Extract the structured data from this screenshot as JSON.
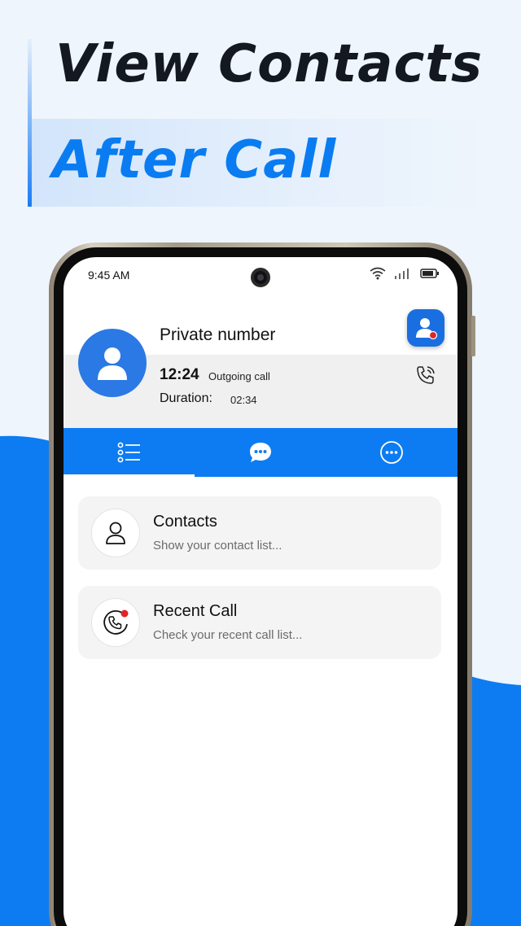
{
  "promo": {
    "headline_line1": "View Contacts",
    "headline_line2": "After Call"
  },
  "colors": {
    "accent": "#0d7cf2",
    "background": "#eef5fc",
    "headline_dark": "#141820",
    "missed_dot": "#e02424"
  },
  "status_bar": {
    "time": "9:45 AM",
    "icons": [
      "wifi-icon",
      "signal-icon",
      "battery-icon"
    ]
  },
  "caller": {
    "name": "Private number",
    "time": "12:24",
    "call_type": "Outgoing call",
    "duration_label": "Duration:",
    "duration_value": "02:34",
    "avatar_icon": "person-icon",
    "call_icon": "phone-call-icon"
  },
  "tabs": [
    {
      "icon": "list-icon",
      "active": true
    },
    {
      "icon": "chat-bubble-icon",
      "active": false
    },
    {
      "icon": "more-options-icon",
      "active": false
    }
  ],
  "menu": [
    {
      "title": "Contacts",
      "subtitle": "Show your contact list...",
      "icon": "person-outline-icon"
    },
    {
      "title": "Recent Call",
      "subtitle": "Check your recent call list...",
      "icon": "recent-call-icon"
    }
  ]
}
